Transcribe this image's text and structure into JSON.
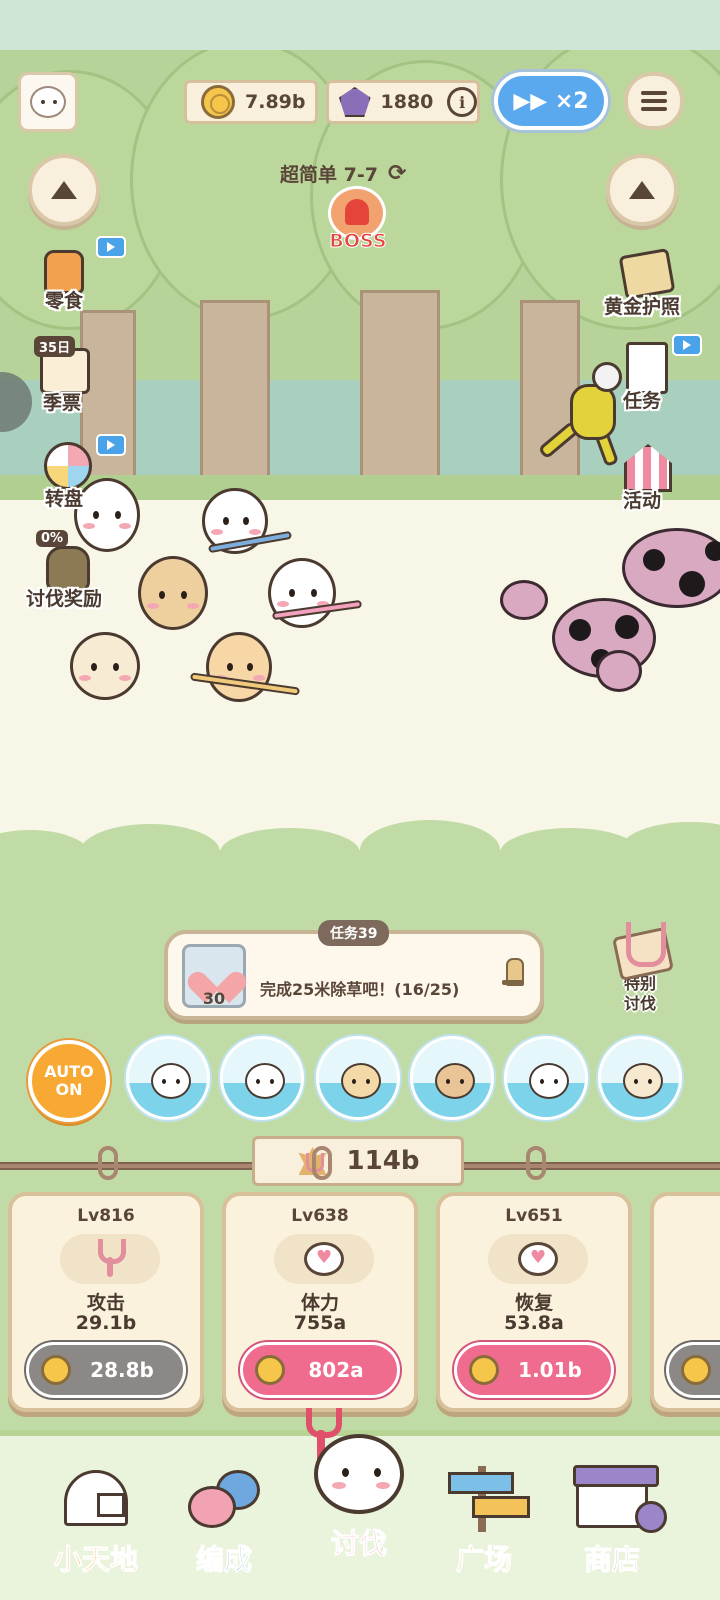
{
  "header": {
    "coins": "7.89b",
    "gems": "1880",
    "info_icon": "info-icon",
    "speed_label": "▶▶ ×2",
    "menu_icon": "menu-list-icon"
  },
  "stage": {
    "label": "超简单 7-7",
    "refresh_icon": "refresh-icon",
    "boss_label": "BOSS"
  },
  "left_menu": [
    {
      "label": "零食",
      "icon": "snack-icon",
      "has_video": true
    },
    {
      "label": "季票",
      "icon": "season-pass-icon",
      "badge": "35日"
    },
    {
      "label": "转盘",
      "icon": "roulette-icon",
      "has_video": true
    },
    {
      "label": "讨伐奖励",
      "icon": "reward-bag-icon",
      "badge": "0%"
    }
  ],
  "right_menu": [
    {
      "label": "黄金护照",
      "icon": "gold-passport-icon"
    },
    {
      "label": "任务",
      "icon": "task-list-icon",
      "has_video": true
    },
    {
      "label": "活动",
      "icon": "event-tent-icon"
    }
  ],
  "quest": {
    "tag": "任务39",
    "text": "完成25米除草吧！(16/25)",
    "reward_count": "30",
    "progress": 0.64
  },
  "special": {
    "label": "特别讨伐"
  },
  "auto": {
    "line1": "AUTO",
    "line2": "ON"
  },
  "party_colors": [
    "#ffffff",
    "#ffffff",
    "#f3d8a8",
    "#e8c496",
    "#ffffff",
    "#f7e9cf"
  ],
  "power": {
    "value": "114b"
  },
  "cards": [
    {
      "level": "Lv816",
      "name": "攻击",
      "value": "29.1b",
      "cost": "28.8b",
      "affordable": false
    },
    {
      "level": "Lv638",
      "name": "体力",
      "value": "755a",
      "cost": "802a",
      "affordable": true
    },
    {
      "level": "Lv651",
      "name": "恢复",
      "value": "53.8a",
      "cost": "1.01b",
      "affordable": true
    }
  ],
  "nav": [
    {
      "label": "小天地",
      "color": "#f29a2e"
    },
    {
      "label": "编成",
      "color": "#5b8fd6"
    },
    {
      "label": "讨伐",
      "color": "#e0506a"
    },
    {
      "label": "广场",
      "color": "#f29a2e"
    },
    {
      "label": "商店",
      "color": "#8c6fc0"
    }
  ]
}
